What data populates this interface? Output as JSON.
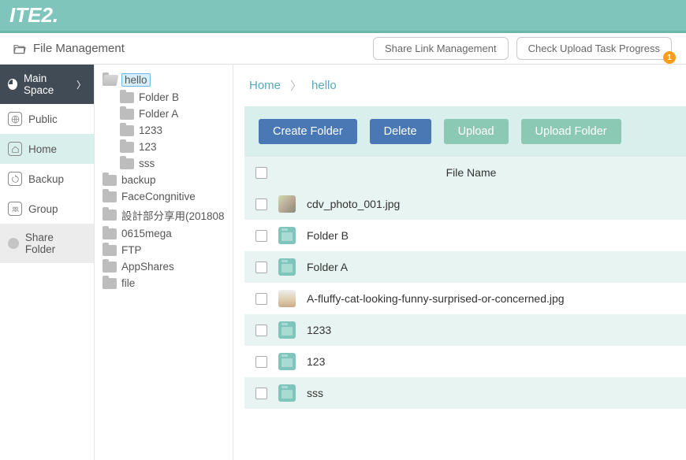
{
  "brand": "ITE2.",
  "header": {
    "title": "File Management",
    "share_link_btn": "Share Link Management",
    "upload_progress_btn": "Check Upload Task Progress",
    "upload_progress_badge": "1"
  },
  "leftnav": {
    "items": [
      {
        "label": "Main Space",
        "key": "main-space"
      },
      {
        "label": "Public",
        "key": "public"
      },
      {
        "label": "Home",
        "key": "home"
      },
      {
        "label": "Backup",
        "key": "backup"
      },
      {
        "label": "Group",
        "key": "group"
      },
      {
        "label": "Share Folder",
        "key": "share-folder"
      }
    ]
  },
  "tree": {
    "root": "hello",
    "root_children": [
      "Folder B",
      "Folder A",
      "1233",
      "123",
      "sss"
    ],
    "siblings": [
      "backup",
      "FaceCongnitive",
      "設計部分享用(201808",
      "0615mega",
      "FTP",
      "AppShares",
      "file"
    ]
  },
  "breadcrumb": {
    "home": "Home",
    "current": "hello"
  },
  "toolbar": {
    "create_folder": "Create Folder",
    "delete": "Delete",
    "upload": "Upload",
    "upload_folder": "Upload Folder"
  },
  "table": {
    "header_name": "File Name",
    "rows": [
      {
        "type": "image",
        "name": "cdv_photo_001.jpg"
      },
      {
        "type": "folder",
        "name": "Folder B"
      },
      {
        "type": "folder",
        "name": "Folder A"
      },
      {
        "type": "image",
        "name": "A-fluffy-cat-looking-funny-surprised-or-concerned.jpg"
      },
      {
        "type": "folder",
        "name": "1233"
      },
      {
        "type": "folder",
        "name": "123"
      },
      {
        "type": "folder",
        "name": "sss"
      }
    ]
  }
}
